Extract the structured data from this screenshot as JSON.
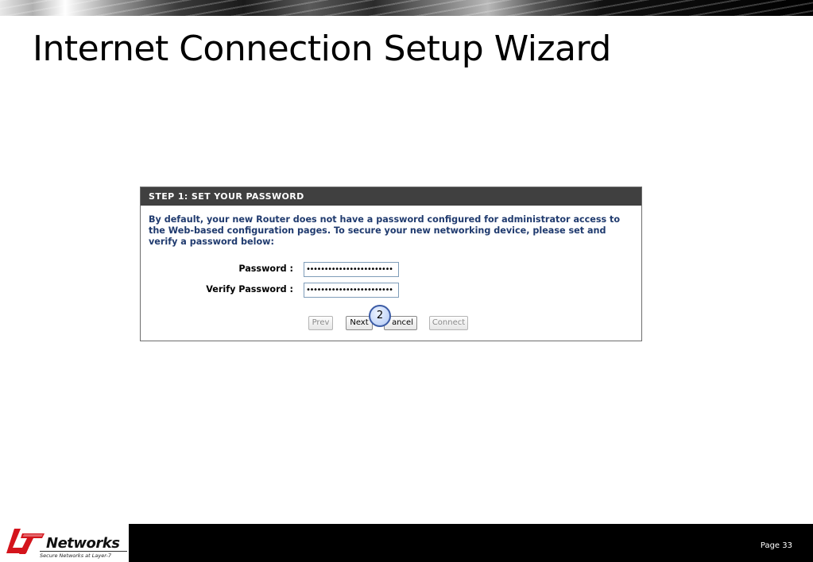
{
  "slide": {
    "title": "Internet Connection Setup Wizard",
    "page_label": "Page 33"
  },
  "wizard": {
    "header": "STEP 1: SET YOUR PASSWORD",
    "description": "By default, your new Router does not have a password configured for administrator access to the Web-based configuration pages. To secure your new networking device, please set and verify a password below:",
    "fields": {
      "password_label": "Password :",
      "password_value": "••••••••••••••••••••••••",
      "verify_label": "Verify Password :",
      "verify_value": "••••••••••••••••••••••••"
    },
    "buttons": {
      "prev": "Prev",
      "next": "Next",
      "cancel": "ancel",
      "connect": "Connect"
    },
    "callout_number": "2"
  },
  "logo": {
    "word": "Networks",
    "tagline": "Secure Networks at Layer-7",
    "colors": {
      "red": "#d4141c",
      "black": "#111111"
    }
  },
  "colors": {
    "header_bg": "#404040",
    "description_text": "#1f3a6e",
    "footer_bg": "#000000"
  }
}
